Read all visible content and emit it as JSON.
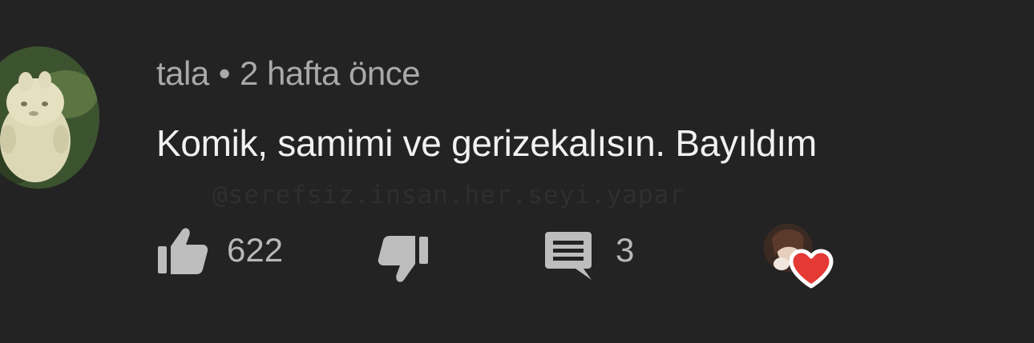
{
  "comment": {
    "author": "tala",
    "separator": "•",
    "time": "2 hafta önce",
    "text": "Komik, samimi ve gerizekalısın. Bayıldım",
    "watermark": "@serefsiz.insan.her.seyi.yapar",
    "like_count": "622",
    "reply_count": "3"
  },
  "icons": {
    "like": "thumbs-up-icon",
    "dislike": "thumbs-down-icon",
    "reply": "comment-icon",
    "creator_heart": "heart-icon"
  },
  "colors": {
    "background": "#232323",
    "meta_text": "#a9a9a9",
    "body_text": "#f1f1f1",
    "icon": "#bdbdbd",
    "heart": "#e53935"
  }
}
